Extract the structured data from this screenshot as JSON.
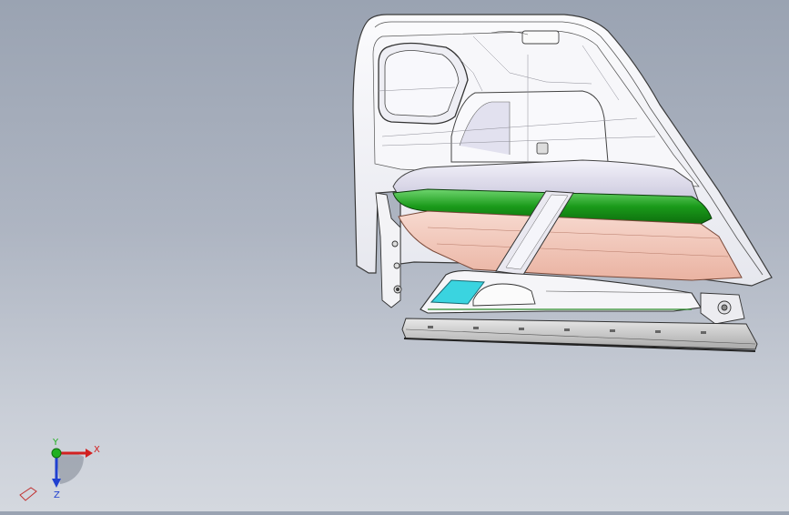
{
  "viewport": {
    "background_top": "#9aa3b2",
    "background_bottom": "#d4d8df"
  },
  "model": {
    "outline_color": "#3a3a3a",
    "shell_fill": "#f4f4f7",
    "armrest_color": "#1fa01f",
    "pocket_color": "#f2c6b8",
    "handle_color": "#3ad4e0",
    "rail_color": "#cfcfcf"
  },
  "triad": {
    "x_label": "X",
    "y_label": "Y",
    "z_label": "Z",
    "x_color": "#d22020",
    "y_color": "#20b020",
    "z_color": "#2040d0"
  }
}
